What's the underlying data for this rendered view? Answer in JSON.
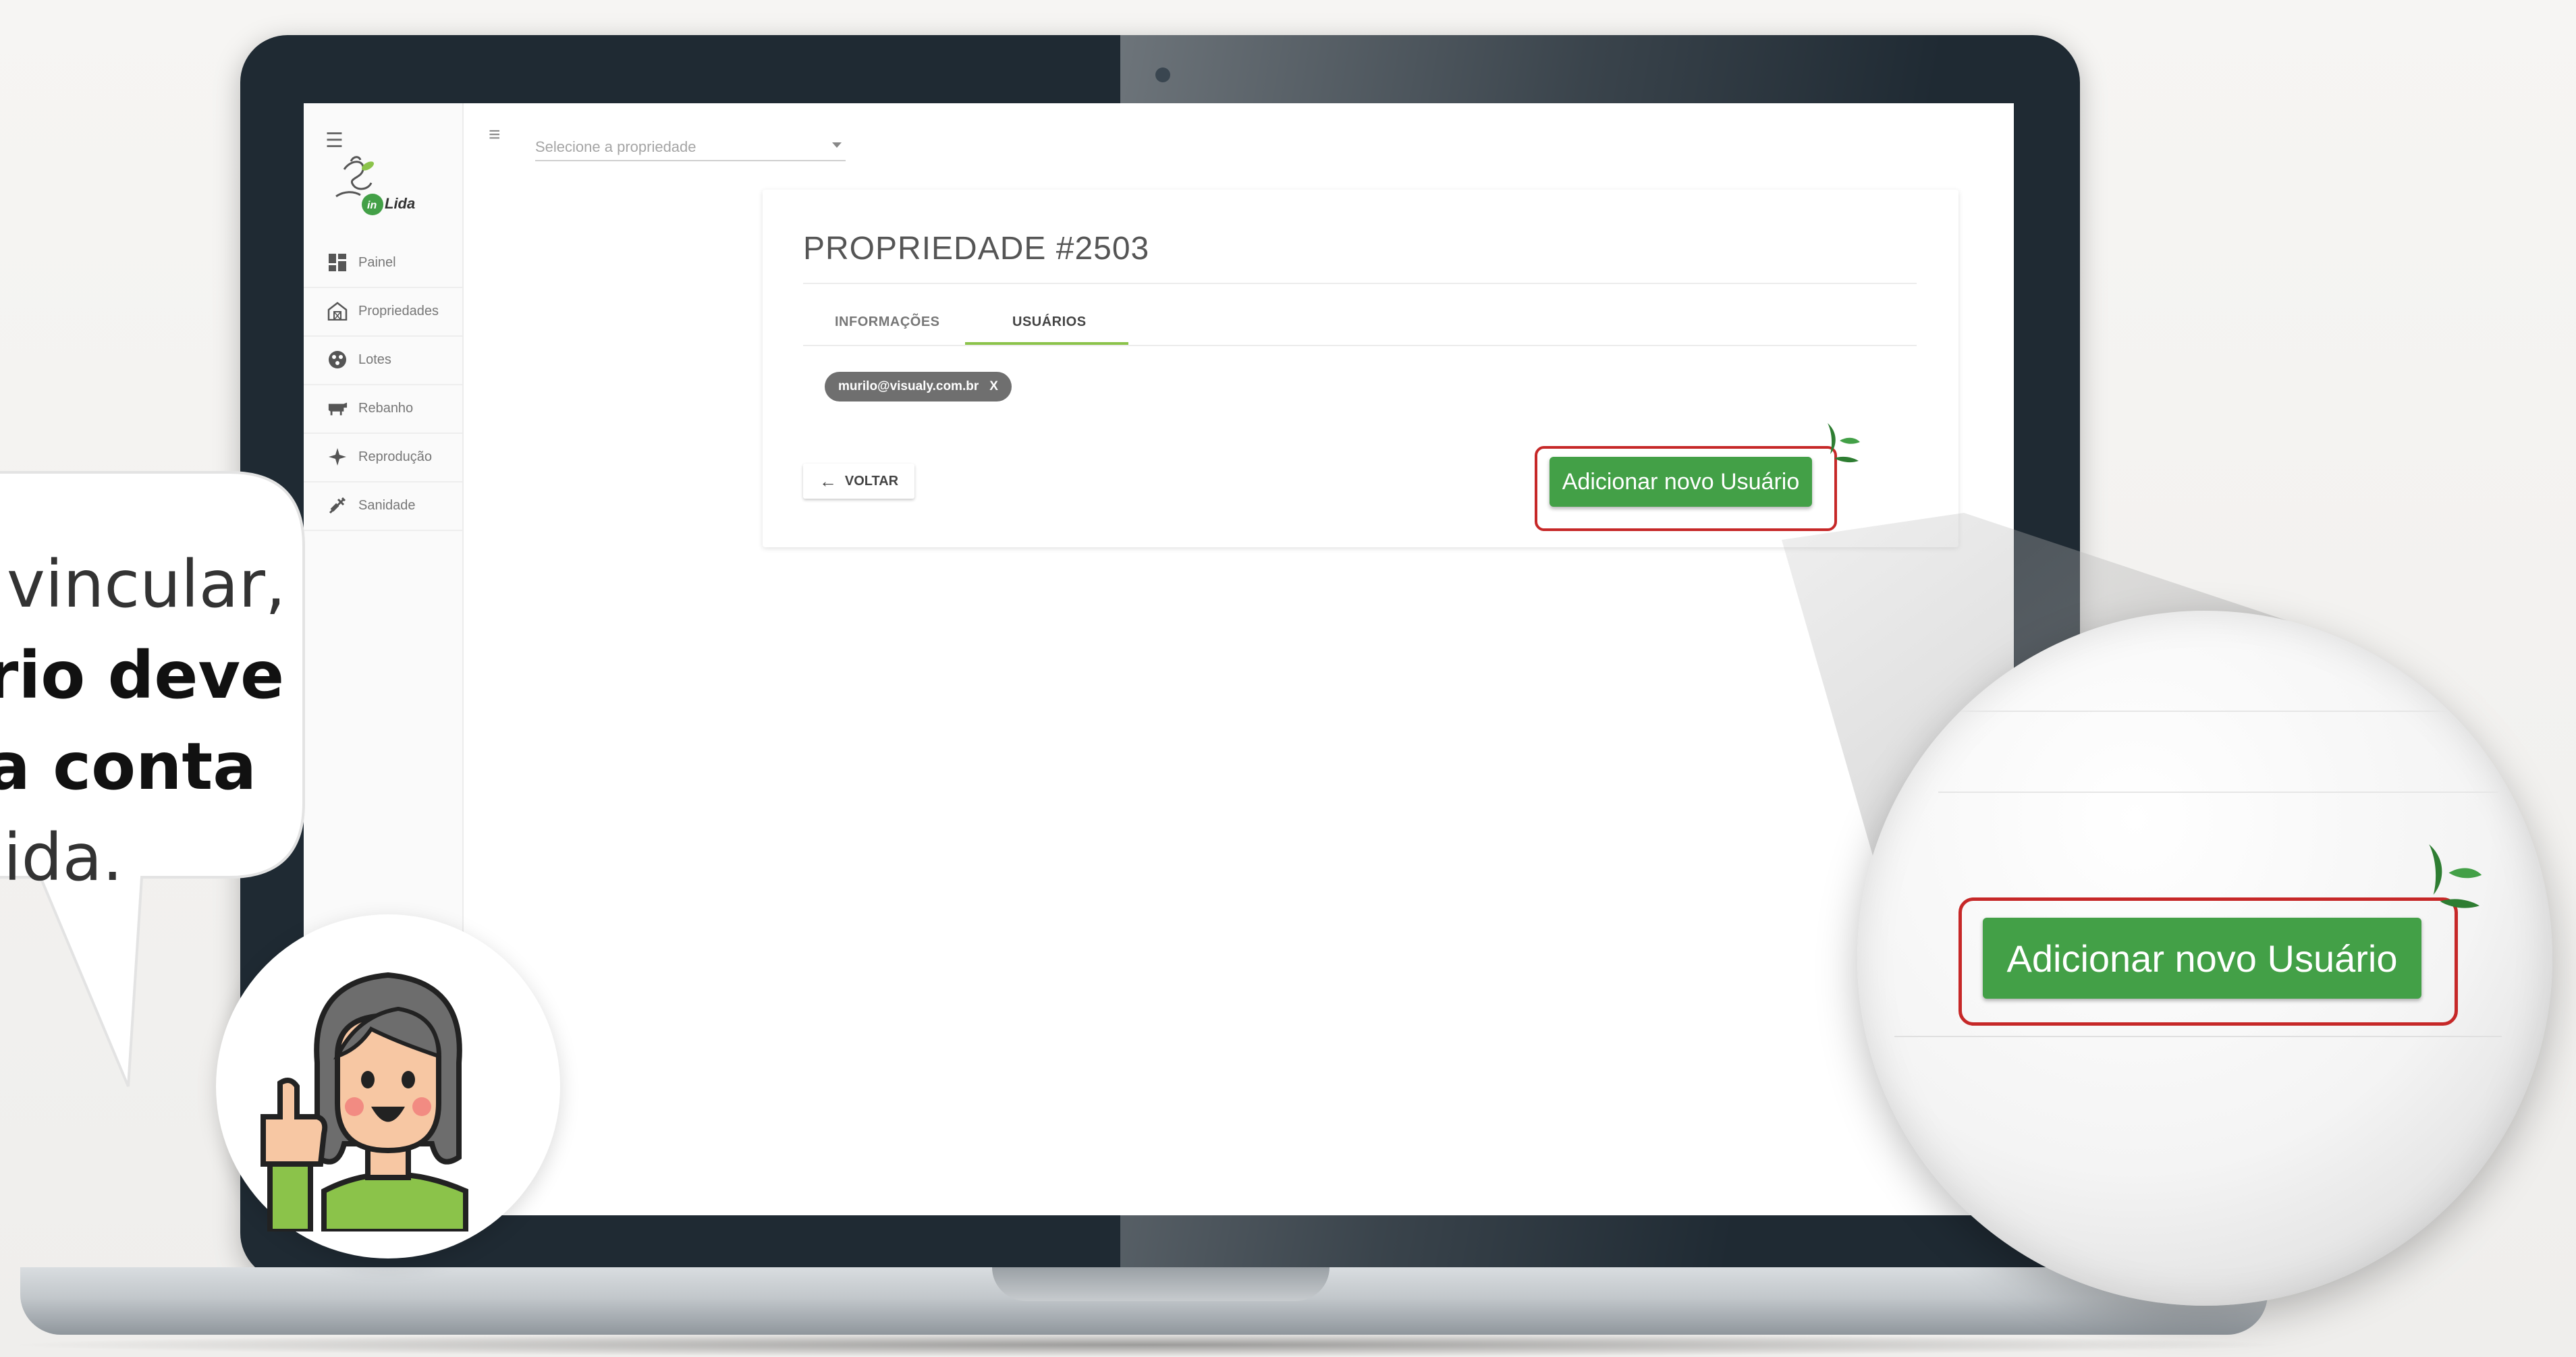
{
  "sidebar": {
    "items": [
      {
        "label": "Painel",
        "icon": "dashboard-icon"
      },
      {
        "label": "Propriedades",
        "icon": "barn-icon"
      },
      {
        "label": "Lotes",
        "icon": "lots-icon"
      },
      {
        "label": "Rebanho",
        "icon": "cow-icon"
      },
      {
        "label": "Reprodução",
        "icon": "reproduction-icon"
      },
      {
        "label": "Sanidade",
        "icon": "syringe-icon"
      }
    ]
  },
  "brand": {
    "logo_text": "inLida",
    "logo_badge": "in",
    "logo_word": "Lida"
  },
  "header": {
    "property_select_placeholder": "Selecione a propriedade"
  },
  "card": {
    "title": "PROPRIEDADE #2503",
    "tabs": [
      {
        "label": "INFORMAÇÕES"
      },
      {
        "label": "USUÁRIOS",
        "active": true
      }
    ],
    "user_chip": {
      "email": "murilo@visualy.com.br",
      "remove_label": "X"
    },
    "back_button_label": "VOLTAR",
    "add_user_button_label": "Adicionar novo Usuário"
  },
  "magnifier": {
    "add_user_button_label": "Adicionar novo Usuário"
  },
  "speech_bubble": {
    "lines": [
      {
        "text": "vincular,",
        "bold": false
      },
      {
        "text": "rio deve",
        "bold": true
      },
      {
        "text": "a conta",
        "bold": true
      },
      {
        "text": "ida.",
        "bold": false
      }
    ]
  },
  "colors": {
    "accent_green": "#43a047",
    "tab_underline": "#8bc34a",
    "highlight_red": "#c62828",
    "laptop_frame": "#1f2a33"
  }
}
